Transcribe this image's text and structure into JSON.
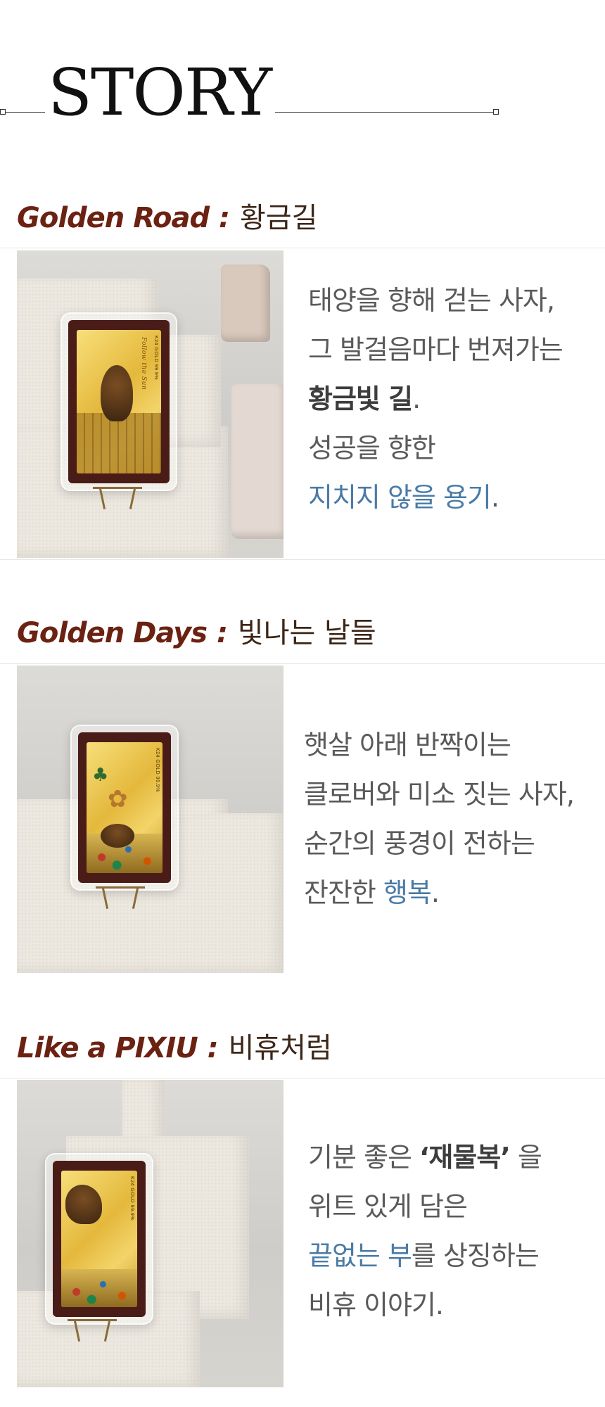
{
  "header": {
    "title": "STORY"
  },
  "sections": [
    {
      "title_en": "Golden Road",
      "colon": " : ",
      "title_ko": "황금길",
      "card_stamp": "K24 GOLD 99.9%",
      "card_script": "Follow the Sun",
      "lines": [
        {
          "text": "태양을 향해 걷는 사자,"
        },
        {
          "text": "그 발걸음마다 번져가는"
        },
        {
          "bold": "황금빛 길",
          "after": "."
        },
        {
          "text": "성공을 향한"
        },
        {
          "blue": "지치지 않을 용기",
          "after": "."
        }
      ]
    },
    {
      "title_en": "Golden Days",
      "colon": " : ",
      "title_ko": "빛나는 날들",
      "card_stamp": "K24 GOLD 99.9%",
      "lines": [
        {
          "text": "햇살 아래 반짝이는"
        },
        {
          "text": "클로버와 미소 짓는 사자,"
        },
        {
          "text": "순간의 풍경이 전하는"
        },
        {
          "before": "잔잔한 ",
          "blue": "행복",
          "after": "."
        }
      ]
    },
    {
      "title_en": "Like a PIXIU",
      "colon": " : ",
      "title_ko": "비휴처럼",
      "card_stamp": "K24 GOLD 99.9%",
      "lines": [
        {
          "before": "기분 좋은 ",
          "bold": "‘재물복’",
          "after": " 을"
        },
        {
          "text": "위트 있게 담은"
        },
        {
          "blue": "끝없는 부",
          "after": "를 상징하는"
        },
        {
          "text": "비휴 이야기."
        }
      ]
    }
  ],
  "colors": {
    "title_brown": "#6b2212",
    "accent_blue": "#4a7ba6",
    "body_gray": "#5a5a5a"
  }
}
